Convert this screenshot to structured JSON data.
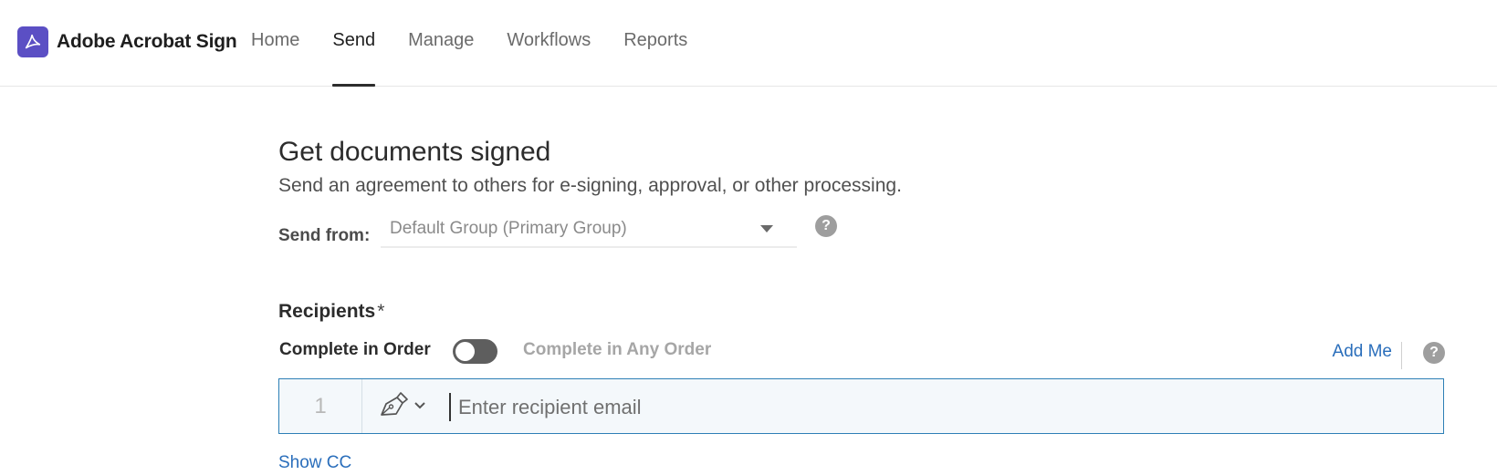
{
  "app": {
    "name": "Adobe Acrobat Sign",
    "brand_color": "#5b4fc4"
  },
  "nav": {
    "items": [
      {
        "label": "Home"
      },
      {
        "label": "Send"
      },
      {
        "label": "Manage"
      },
      {
        "label": "Workflows"
      },
      {
        "label": "Reports"
      }
    ],
    "active": "Send"
  },
  "page": {
    "title": "Get documents signed",
    "subtitle": "Send an agreement to others for e-signing, approval, or other processing."
  },
  "send_from": {
    "label": "Send from:",
    "selected": "Default Group (Primary Group)",
    "help": "?"
  },
  "recipients": {
    "title": "Recipients",
    "required_mark": "*",
    "complete_in_order_label": "Complete in Order",
    "complete_any_order_label": "Complete in Any Order",
    "add_me_label": "Add Me",
    "help": "?",
    "rows": [
      {
        "index": "1",
        "role_icon": "pen-nib-icon",
        "placeholder": "Enter recipient email"
      }
    ],
    "show_cc_label": "Show CC"
  },
  "colors": {
    "link": "#2a6ebb",
    "input_border_focus": "#2d7fb6",
    "toggle_track": "#5e5e5e"
  }
}
